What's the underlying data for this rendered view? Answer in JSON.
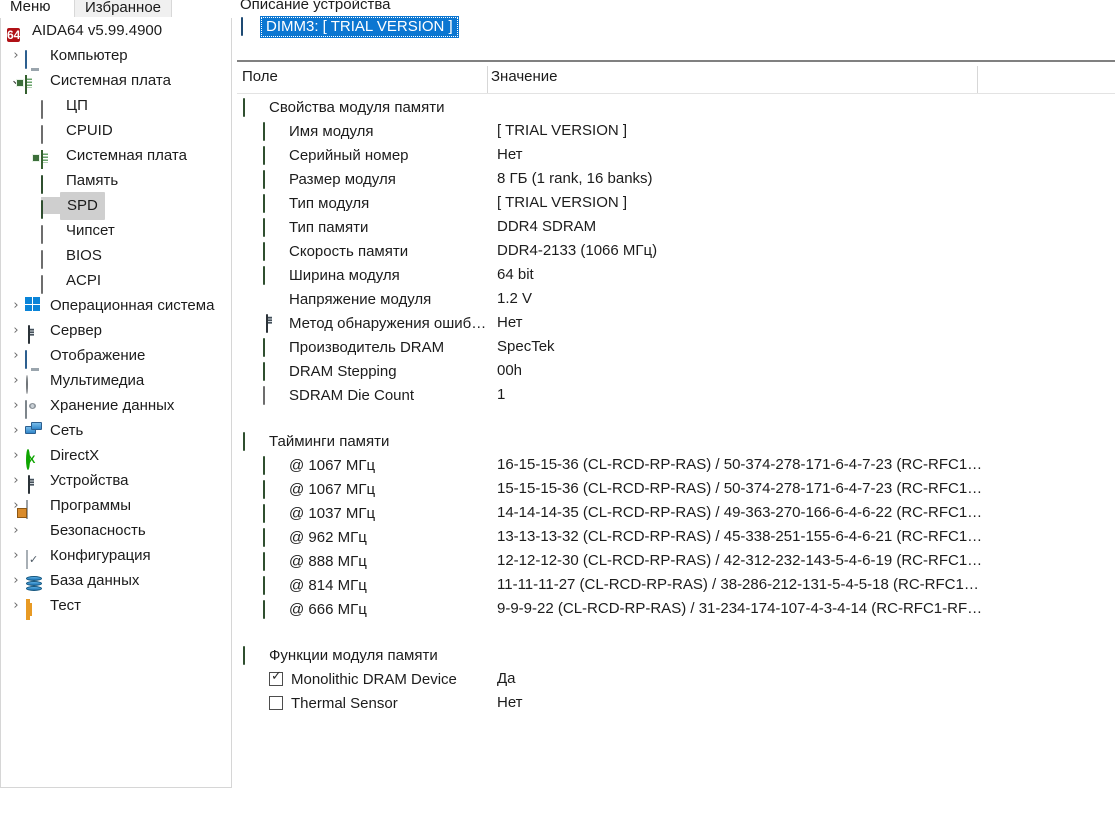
{
  "app": {
    "tabs": [
      {
        "label": "Меню",
        "active": false
      },
      {
        "label": "Избранное",
        "active": true
      }
    ],
    "root_label": "AIDA64 v5.99.4900",
    "root_icon": "aida64-logo-icon"
  },
  "sidebar": {
    "items": [
      {
        "label": "Компьютер",
        "icon": "monitor-icon",
        "indent": 0,
        "chevron": "collapsed",
        "selected": false
      },
      {
        "label": "Системная плата",
        "icon": "motherboard-icon",
        "indent": 0,
        "chevron": "expanded",
        "selected": false
      },
      {
        "label": "ЦП",
        "icon": "cpu-chip-icon",
        "indent": 1,
        "chevron": "none",
        "selected": false
      },
      {
        "label": "CPUID",
        "icon": "cpu-chip-icon",
        "indent": 1,
        "chevron": "none",
        "selected": false
      },
      {
        "label": "Системная плата",
        "icon": "motherboard-icon",
        "indent": 1,
        "chevron": "none",
        "selected": false
      },
      {
        "label": "Память",
        "icon": "memory-module-icon",
        "indent": 1,
        "chevron": "none",
        "selected": false
      },
      {
        "label": "SPD",
        "icon": "memory-module-icon",
        "indent": 1,
        "chevron": "none",
        "selected": true
      },
      {
        "label": "Чипсет",
        "icon": "cpu-chip-icon",
        "indent": 1,
        "chevron": "none",
        "selected": false
      },
      {
        "label": "BIOS",
        "icon": "cpu-chip-icon",
        "indent": 1,
        "chevron": "none",
        "selected": false
      },
      {
        "label": "ACPI",
        "icon": "cpu-chip-icon",
        "indent": 1,
        "chevron": "none",
        "selected": false
      },
      {
        "label": "Операционная система",
        "icon": "windows-logo-icon",
        "indent": 0,
        "chevron": "collapsed",
        "selected": false
      },
      {
        "label": "Сервер",
        "icon": "server-tower-icon",
        "indent": 0,
        "chevron": "collapsed",
        "selected": false
      },
      {
        "label": "Отображение",
        "icon": "monitor-icon",
        "indent": 0,
        "chevron": "collapsed",
        "selected": false
      },
      {
        "label": "Мультимедиа",
        "icon": "disc-icon",
        "indent": 0,
        "chevron": "collapsed",
        "selected": false
      },
      {
        "label": "Хранение данных",
        "icon": "disk-drive-icon",
        "indent": 0,
        "chevron": "collapsed",
        "selected": false
      },
      {
        "label": "Сеть",
        "icon": "network-icon",
        "indent": 0,
        "chevron": "collapsed",
        "selected": false
      },
      {
        "label": "DirectX",
        "icon": "directx-icon",
        "indent": 0,
        "chevron": "collapsed",
        "selected": false
      },
      {
        "label": "Устройства",
        "icon": "server-tower-icon",
        "indent": 0,
        "chevron": "collapsed",
        "selected": false
      },
      {
        "label": "Программы",
        "icon": "programs-icon",
        "indent": 0,
        "chevron": "collapsed",
        "selected": false
      },
      {
        "label": "Безопасность",
        "icon": "shield-icon",
        "indent": 0,
        "chevron": "collapsed",
        "selected": false
      },
      {
        "label": "Конфигурация",
        "icon": "configuration-icon",
        "indent": 0,
        "chevron": "collapsed",
        "selected": false
      },
      {
        "label": "База данных",
        "icon": "database-icon",
        "indent": 0,
        "chevron": "collapsed",
        "selected": false
      },
      {
        "label": "Тест",
        "icon": "benchmark-icon",
        "indent": 0,
        "chevron": "collapsed",
        "selected": false
      }
    ]
  },
  "main": {
    "device_header": "Описание устройства",
    "selected_device": "DIMM3: [ TRIAL VERSION ]",
    "selected_device_icon": "memory-module-icon",
    "columns": {
      "field": "Поле",
      "value": "Значение"
    },
    "sections": [
      {
        "title": "Свойства модуля памяти",
        "icon": "memory-module-icon",
        "rows": [
          {
            "icon": "memory-module-icon",
            "label": "Имя модуля",
            "value": "[ TRIAL VERSION ]"
          },
          {
            "icon": "memory-module-icon",
            "label": "Серийный номер",
            "value": "Нет"
          },
          {
            "icon": "memory-module-icon",
            "label": "Размер модуля",
            "value": "8 ГБ  (1 rank, 16 banks)"
          },
          {
            "icon": "memory-module-icon",
            "label": "Тип модуля",
            "value": "[ TRIAL VERSION ]"
          },
          {
            "icon": "memory-module-icon",
            "label": "Тип памяти",
            "value": "DDR4 SDRAM"
          },
          {
            "icon": "memory-module-icon",
            "label": "Скорость памяти",
            "value": "DDR4-2133 (1066 МГц)"
          },
          {
            "icon": "memory-module-icon",
            "label": "Ширина модуля",
            "value": "64 bit"
          },
          {
            "icon": "voltage-bolt-icon",
            "label": "Напряжение модуля",
            "value": "1.2 V"
          },
          {
            "icon": "server-tower-icon",
            "label": "Метод обнаружения ошиб…",
            "value": "Нет"
          },
          {
            "icon": "memory-module-icon",
            "label": "Производитель DRAM",
            "value": "SpecTek"
          },
          {
            "icon": "memory-module-icon",
            "label": "DRAM Stepping",
            "value": "00h"
          },
          {
            "icon": "cpu-chip-icon",
            "label": "SDRAM Die Count",
            "value": "1"
          }
        ]
      },
      {
        "title": "Тайминги памяти",
        "icon": "memory-module-icon",
        "rows": [
          {
            "icon": "memory-module-icon",
            "label": "@ 1067 МГц",
            "value": "16-15-15-36  (CL-RCD-RP-RAS) / 50-374-278-171-6-4-7-23  (RC-RFC1…"
          },
          {
            "icon": "memory-module-icon",
            "label": "@ 1067 МГц",
            "value": "15-15-15-36  (CL-RCD-RP-RAS) / 50-374-278-171-6-4-7-23  (RC-RFC1…"
          },
          {
            "icon": "memory-module-icon",
            "label": "@ 1037 МГц",
            "value": "14-14-14-35  (CL-RCD-RP-RAS) / 49-363-270-166-6-4-6-22  (RC-RFC1…"
          },
          {
            "icon": "memory-module-icon",
            "label": "@ 962 МГц",
            "value": "13-13-13-32  (CL-RCD-RP-RAS) / 45-338-251-155-6-4-6-21  (RC-RFC1…"
          },
          {
            "icon": "memory-module-icon",
            "label": "@ 888 МГц",
            "value": "12-12-12-30  (CL-RCD-RP-RAS) / 42-312-232-143-5-4-6-19  (RC-RFC1…"
          },
          {
            "icon": "memory-module-icon",
            "label": "@ 814 МГц",
            "value": "11-11-11-27  (CL-RCD-RP-RAS) / 38-286-212-131-5-4-5-18  (RC-RFC1…"
          },
          {
            "icon": "memory-module-icon",
            "label": "@ 666 МГц",
            "value": "9-9-9-22  (CL-RCD-RP-RAS) / 31-234-174-107-4-3-4-14  (RC-RFC1-RF…"
          }
        ]
      },
      {
        "title": "Функции модуля памяти",
        "icon": "memory-module-icon",
        "rows": [
          {
            "icon": "checkbox-checked-icon",
            "label": "Monolithic DRAM Device",
            "value": "Да",
            "checked": true
          },
          {
            "icon": "checkbox-unchecked-icon",
            "label": "Thermal Sensor",
            "value": "Нет",
            "checked": false
          }
        ]
      }
    ]
  },
  "colors": {
    "selection_blue": "#0b76d1",
    "tree_selection_gray": "#cfcfcf",
    "header_rule": "#808080",
    "text": "#1c1c1c"
  }
}
